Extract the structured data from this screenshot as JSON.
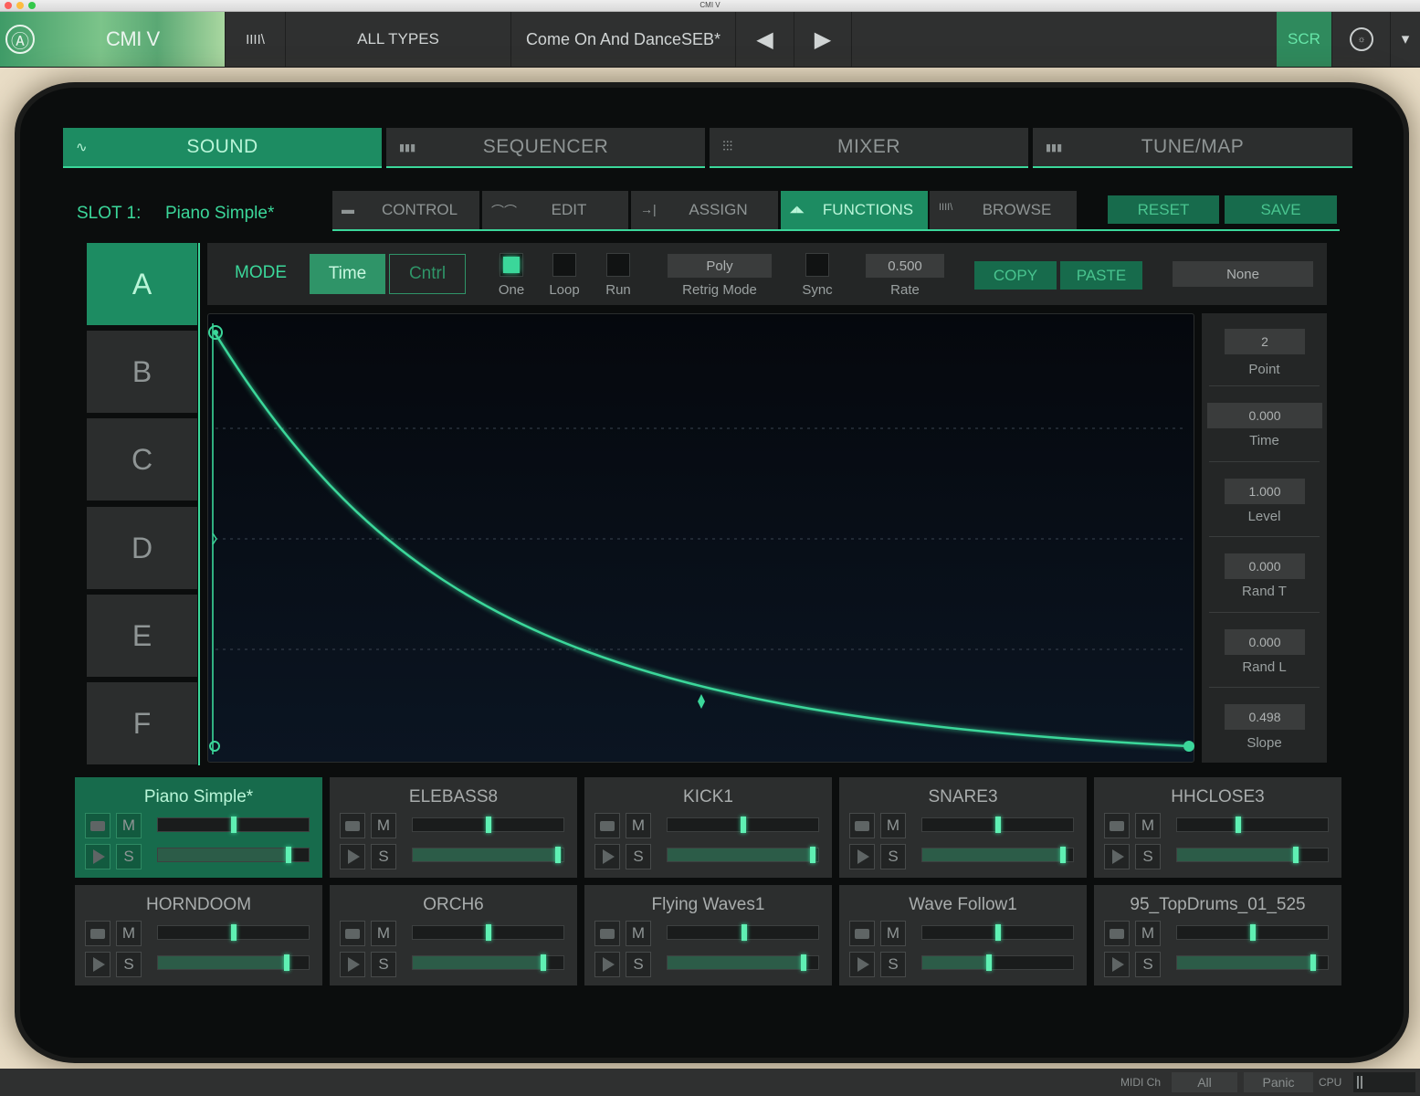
{
  "window": {
    "title": "CMI V"
  },
  "toolbar": {
    "app_name": "CMI V",
    "browser_icon": "IIII\\",
    "type_filter": "ALL TYPES",
    "preset_name": "Come On And DanceSEB*",
    "prev_glyph": "◀",
    "next_glyph": "▶",
    "scr_label": "SCR",
    "settings_glyph": "☼",
    "dropdown_glyph": "▾"
  },
  "main_tabs": [
    {
      "label": "SOUND",
      "icon": "waveform-icon",
      "glyph": "∿"
    },
    {
      "label": "SEQUENCER",
      "icon": "sequencer-icon",
      "glyph": "▮▮▮"
    },
    {
      "label": "MIXER",
      "icon": "mixer-sliders-icon",
      "glyph": "⫶⫶⫶"
    },
    {
      "label": "TUNE/MAP",
      "icon": "keyboard-icon",
      "glyph": "▮▮▮"
    }
  ],
  "slot": {
    "label": "SLOT 1:",
    "name": "Piano Simple*"
  },
  "sub_tabs": [
    {
      "label": "CONTROL",
      "icon": "control-icon",
      "glyph": "▬"
    },
    {
      "label": "EDIT",
      "icon": "edit-wave-icon",
      "glyph": "⌒⌒"
    },
    {
      "label": "ASSIGN",
      "icon": "assign-arrow-icon",
      "glyph": "→|"
    },
    {
      "label": "FUNCTIONS",
      "icon": "envelope-icon",
      "glyph": "◢◣"
    },
    {
      "label": "BROWSE",
      "icon": "browse-icon",
      "glyph": "IIII\\"
    }
  ],
  "actions": {
    "reset": "RESET",
    "save": "SAVE"
  },
  "functions": [
    "A",
    "B",
    "C",
    "D",
    "E",
    "F"
  ],
  "controls": {
    "mode_label": "MODE",
    "mode_time": "Time",
    "mode_cntrl": "Cntrl",
    "one_label": "One",
    "loop_label": "Loop",
    "run_label": "Run",
    "retrig_value": "Poly",
    "retrig_label": "Retrig Mode",
    "sync_label": "Sync",
    "rate_value": "0.500",
    "rate_label": "Rate",
    "copy_label": "COPY",
    "paste_label": "PASTE",
    "target_value": "None"
  },
  "params": [
    {
      "value": "2",
      "label": "Point"
    },
    {
      "value": "0.000",
      "label": "Time"
    },
    {
      "value": "1.000",
      "label": "Level"
    },
    {
      "value": "0.000",
      "label": "Rand T"
    },
    {
      "value": "0.000",
      "label": "Rand L"
    },
    {
      "value": "0.498",
      "label": "Slope"
    }
  ],
  "strip_labels": {
    "mute": "M",
    "solo": "S"
  },
  "strips": [
    {
      "name": "Piano Simple*",
      "top_level": 0.5,
      "bottom_level": 0.88
    },
    {
      "name": "ELEBASS8",
      "top_level": 0.5,
      "bottom_level": 0.98
    },
    {
      "name": "KICK1",
      "top_level": 0.5,
      "bottom_level": 0.98
    },
    {
      "name": "SNARE3",
      "top_level": 0.5,
      "bottom_level": 0.95
    },
    {
      "name": "HHCLOSE3",
      "top_level": 0.4,
      "bottom_level": 0.8
    },
    {
      "name": "HORNDOOM",
      "top_level": 0.5,
      "bottom_level": 0.87
    },
    {
      "name": "ORCH6",
      "top_level": 0.5,
      "bottom_level": 0.88
    },
    {
      "name": "Flying Waves1",
      "top_level": 0.51,
      "bottom_level": 0.92
    },
    {
      "name": "Wave Follow1",
      "top_level": 0.5,
      "bottom_level": 0.44
    },
    {
      "name": "95_TopDrums_01_525",
      "top_level": 0.5,
      "bottom_level": 0.92
    }
  ],
  "statusbar": {
    "midi_label": "MIDI Ch",
    "midi_value": "All",
    "panic": "Panic",
    "cpu_label": "CPU"
  },
  "colors": {
    "accent": "#3bd79a",
    "accent_dark": "#1d8c62",
    "panel": "#2c2e2e",
    "bezel": "#0b0d0d",
    "case": "#e9ddc6"
  }
}
